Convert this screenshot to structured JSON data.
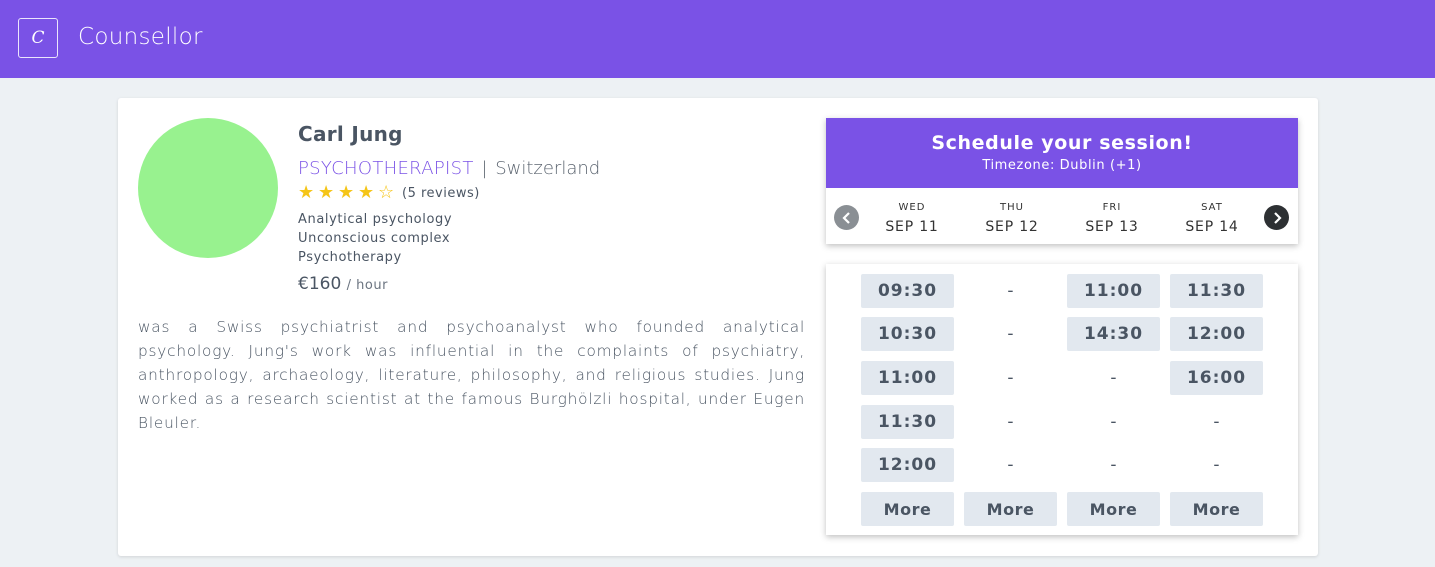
{
  "header": {
    "logo_letter": "C",
    "brand": "Counsellor"
  },
  "profile": {
    "name": "Carl Jung",
    "role": "PSYCHOTHERAPIST",
    "separator": "|",
    "country": "Switzerland",
    "rating": {
      "stars": 4,
      "max": 5,
      "reviews": "(5 reviews)"
    },
    "specialties": [
      "Analytical psychology",
      "Unconscious complex",
      "Psychotherapy"
    ],
    "price": "€160",
    "price_unit": "/ hour",
    "bio": "was a Swiss psychiatrist and psychoanalyst who founded analytical psychology. Jung's work was influential in the complaints of psychiatry, anthropology, archaeology, literature, philosophy, and religious studies. Jung worked as a research scientist at the famous Burghölzli hospital, under Eugen Bleuler.",
    "avatar_color": "#98f28f"
  },
  "schedule": {
    "title": "Schedule your session!",
    "timezone": "Timezone: Dublin (+1)",
    "prev_icon": "chevron-left-icon",
    "next_icon": "chevron-right-icon",
    "days": [
      {
        "dow": "WED",
        "date": "SEP 11",
        "slots": [
          "09:30",
          "10:30",
          "11:00",
          "11:30",
          "12:00"
        ],
        "more": "More"
      },
      {
        "dow": "THU",
        "date": "SEP 12",
        "slots": [
          "-",
          "-",
          "-",
          "-",
          "-"
        ],
        "more": "More"
      },
      {
        "dow": "FRI",
        "date": "SEP 13",
        "slots": [
          "11:00",
          "14:30",
          "-",
          "-",
          "-"
        ],
        "more": "More"
      },
      {
        "dow": "SAT",
        "date": "SEP 14",
        "slots": [
          "11:30",
          "12:00",
          "16:00",
          "-",
          "-"
        ],
        "more": "More"
      }
    ]
  },
  "colors": {
    "accent": "#7a52e6",
    "slot_bg": "#e2e8ef",
    "background": "#edf1f4",
    "star": "#f5c518"
  }
}
